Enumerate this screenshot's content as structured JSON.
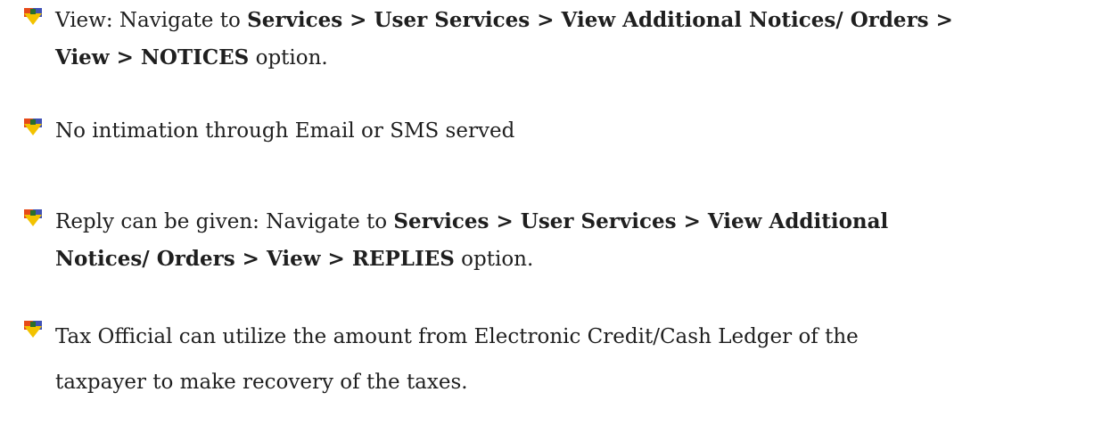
{
  "bullets": [
    {
      "prefix": "View: Navigate to ",
      "path_line1": "Services > User Services > View Additional Notices/ Orders >",
      "path_line2": "View > NOTICES",
      "suffix": " option."
    },
    {
      "text": "No intimation through Email or SMS served"
    },
    {
      "prefix": "Reply can be given: Navigate to ",
      "path_line1": "Services > User Services > View Additional",
      "path_line2": "Notices/ Orders > View > REPLIES",
      "suffix": " option."
    },
    {
      "line1": "Tax Official can utilize the amount from Electronic Credit/Cash Ledger of the",
      "line2": "taxpayer to make recovery of the taxes."
    }
  ],
  "icon": "down-arrow-plus-bullet-icon",
  "colors": {
    "icon_arrow": "#f2c200",
    "icon_accent": "#2a6e2a",
    "icon_red": "#cc2200",
    "text": "#1f1f1f"
  }
}
